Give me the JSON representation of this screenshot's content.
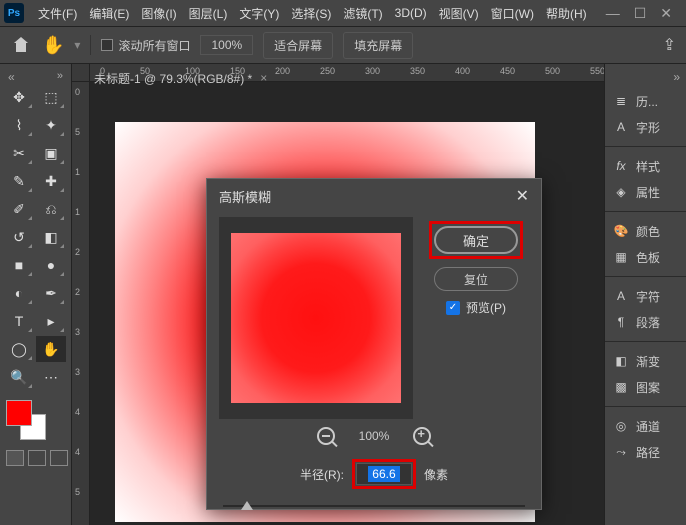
{
  "app": {
    "logo": "Ps"
  },
  "menu": {
    "file": "文件(F)",
    "edit": "编辑(E)",
    "image": "图像(I)",
    "layer": "图层(L)",
    "type": "文字(Y)",
    "select": "选择(S)",
    "filter": "滤镜(T)",
    "threed": "3D(D)",
    "view": "视图(V)",
    "window": "窗口(W)",
    "help": "帮助(H)"
  },
  "options": {
    "scroll_all": "滚动所有窗口",
    "zoom": "100%",
    "fit_screen": "适合屏幕",
    "fill_screen": "填充屏幕"
  },
  "document": {
    "tab_title": "未标题-1 @ 79.3%(RGB/8#) *"
  },
  "ruler": {
    "h": [
      "0",
      "50",
      "100",
      "150",
      "200",
      "250",
      "300",
      "350",
      "400",
      "450",
      "500",
      "550"
    ],
    "v": [
      "0",
      "5",
      "1",
      "1",
      "2",
      "2",
      "3",
      "3",
      "4",
      "4",
      "5"
    ]
  },
  "panels": {
    "history": "历...",
    "glyphs": "字形",
    "styles": "样式",
    "properties": "属性",
    "color": "颜色",
    "swatches": "色板",
    "character": "字符",
    "paragraph": "段落",
    "gradients": "渐变",
    "patterns": "图案",
    "channels": "通道",
    "paths": "路径"
  },
  "dialog": {
    "title": "高斯模糊",
    "ok": "确定",
    "reset": "复位",
    "preview": "预览(P)",
    "zoom_pct": "100%",
    "radius_label": "半径(R):",
    "radius_value": "66.6",
    "radius_unit": "像素"
  },
  "colors": {
    "fg": "#ff0000",
    "bg": "#ffffff"
  }
}
